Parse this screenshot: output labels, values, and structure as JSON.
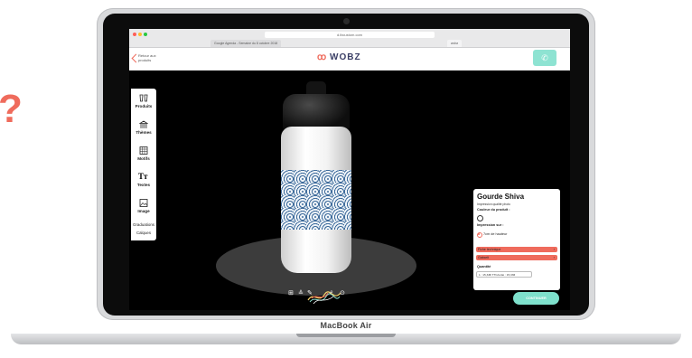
{
  "device": {
    "brand": "MacBook Air"
  },
  "decor": {
    "glyph": "?"
  },
  "browser": {
    "url": "d.lbcustom.com",
    "tabs": [
      "Google Agenda - Semaine du 8 octobre 2018",
      "wobz"
    ]
  },
  "header": {
    "back_line1": "Retour aux",
    "back_line2": "produits",
    "logo": "WOBZ",
    "phone_icon": "phone-icon"
  },
  "sidebar": {
    "items": [
      {
        "label": "Produits",
        "icon": "cups-icon"
      },
      {
        "label": "Thèmes",
        "icon": "monument-icon"
      },
      {
        "label": "Motifs",
        "icon": "pattern-icon"
      },
      {
        "label": "Textes",
        "icon": "text-icon"
      },
      {
        "label": "Image",
        "icon": "image-icon"
      }
    ],
    "extra": [
      "Graduations",
      "Calques"
    ]
  },
  "toolbar": {
    "icons": [
      "grid-icon",
      "layers-icon",
      "pen-icon",
      "zoom-icon",
      "play-icon"
    ]
  },
  "card": {
    "title": "Gourde Shiva",
    "subtitle": "Impression qualité photo",
    "color_label": "Couleur du produit :",
    "print_label": "Impression sur :",
    "print_option": "7cm de hauteur",
    "sheet_label": "Fiche technique",
    "template_label": "Gabarit",
    "quantity_label": "Quantité",
    "quantity_value": "1 : 15,33€ TTC/unité : 15,33€",
    "accent": "#ef6b5c"
  },
  "cta": {
    "label": "CONTINUER",
    "color": "#7ee0cc"
  }
}
